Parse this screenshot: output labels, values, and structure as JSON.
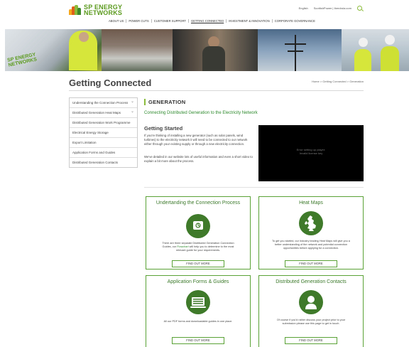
{
  "logo": {
    "line1": "SP ENERGY",
    "line2": "NETWORKS"
  },
  "utility": {
    "lang": "English",
    "links": "ScottishPower | Iberdrola.com"
  },
  "mainnav": [
    "ABOUT US",
    "POWER CUTS",
    "CUSTOMER SUPPORT",
    "GETTING CONNECTED",
    "INVESTMENT & INNOVATION",
    "CORPORATE GOVERNANCE"
  ],
  "van_text": "SP ENERGY NETWORKS",
  "page_title": "Getting Connected",
  "breadcrumb": "Home  >  Getting Connected  >  Generation",
  "sidenav": [
    "Understanding the Connection Process",
    "Distributed Generation Heat Maps",
    "Distributed Generation Work Programme",
    "Electrical Energy Storage",
    "Export Limitation",
    "Application Forms and Guides",
    "Distributed Generation Contacts"
  ],
  "generation": {
    "heading": "GENERATION",
    "subheading": "Connecting Distributed Generation to the Electricity Network",
    "gs_title": "Getting Started",
    "gs_p1": "If you're thinking of installing a new generator (such as solar panels, wind turbines) to the electricity network it will need to be connected to our network either through your existing supply or through a new electricity connection.",
    "gs_p2": "We've detailed in our website lots of useful information and even a short video to explain a bit more about the process.",
    "video_msg_1": "Error setting up player:",
    "video_msg_2": "Invalid license key"
  },
  "cards": [
    {
      "title": "Undertanding the Connection Process",
      "desc_before": "There are three separate Distributed Generation Connection Guides, our ",
      "desc_link": "Flowchart",
      "desc_after": " will help you to determine to the most relevant guide for your requirements.",
      "button": "FIND OUT MORE"
    },
    {
      "title": "Heat Maps",
      "desc": "To get you started, our Industry leading Heat Maps will give you a better understanding of the network and potential connection opportunities before applying for a connection.",
      "button": "FIND OUT MORE"
    },
    {
      "title": "Application Forms & Guides",
      "desc": "All our PDF forms and downloadable guides in one place.",
      "button": "FIND OUT MORE"
    },
    {
      "title": "Distributed Generation Contacts",
      "desc": "Of course if you'd rather discuss your project prior to your submission please use this page to get in touch.",
      "button": "FIND OUT MORE"
    }
  ],
  "colors": {
    "brand_green": "#5b9a1e",
    "card_border": "#5aa136",
    "icon_green": "#3e7a2a"
  },
  "icons": [
    "logo-icon",
    "search-icon",
    "chevron-down-icon",
    "flowchart-icon",
    "uk-map-icon",
    "forms-icon",
    "contact-icon"
  ]
}
